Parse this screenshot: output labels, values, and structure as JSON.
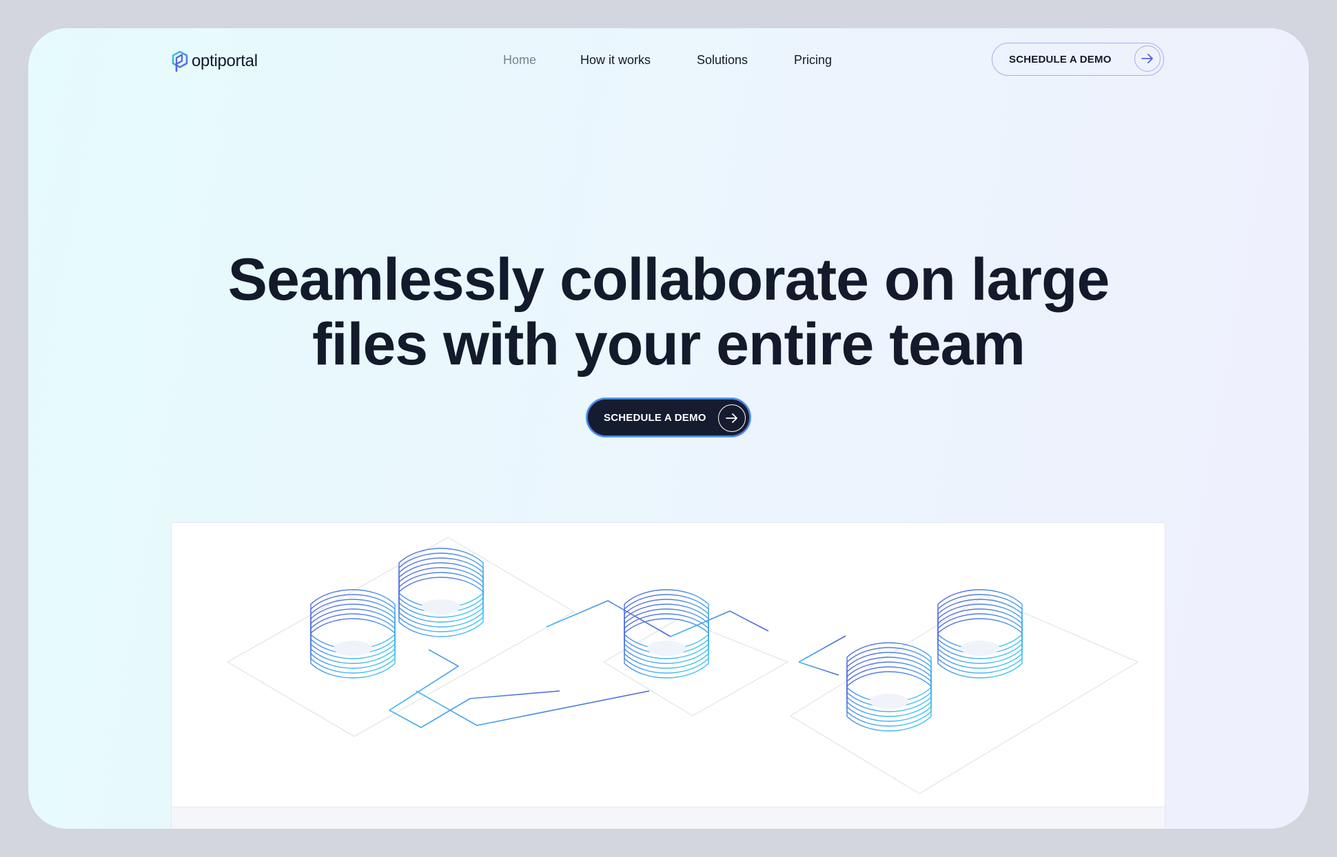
{
  "app": {
    "brand_name": "optiportal"
  },
  "nav": {
    "links": [
      {
        "label": "Home",
        "active": true
      },
      {
        "label": "How it works"
      },
      {
        "label": "Solutions"
      },
      {
        "label": "Pricing"
      }
    ],
    "cta_label": "SCHEDULE A DEMO"
  },
  "hero": {
    "title": "Seamlessly collaborate on large files with your entire team",
    "cta_label": "SCHEDULE A DEMO"
  },
  "colors": {
    "text_dark": "#121a2c",
    "accent_blue": "#5561e0",
    "accent_cyan": "#3fd0f0",
    "nav_inactive": "#7b8190"
  },
  "icons": [
    "optiportal-logo-icon",
    "arrow-right-icon",
    "server-stack-icon"
  ]
}
